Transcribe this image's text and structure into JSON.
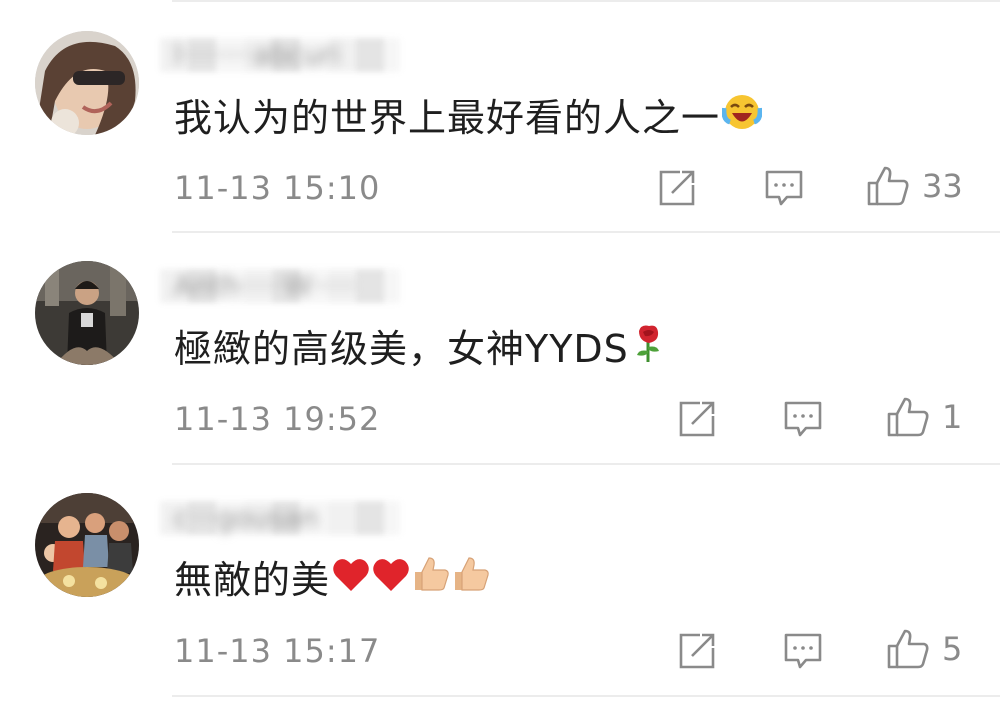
{
  "comments": [
    {
      "username": "l········abcuri",
      "text": "我认为的世界上最好看的人之一",
      "emoji": [
        "laughing-crying-emoji"
      ],
      "timestamp": "11-13 15:10",
      "likes": "33"
    },
    {
      "username": "Anth·····W·····",
      "text": "極緻的高级美，女神YYDS",
      "emoji": [
        "rose-emoji"
      ],
      "timestamp": "11-13 19:52",
      "likes": "1"
    },
    {
      "username": "c···gousan",
      "text": "無敵的美",
      "emoji": [
        "red-heart-emoji",
        "red-heart-emoji",
        "thumbs-up-emoji",
        "thumbs-up-emoji"
      ],
      "timestamp": "11-13 15:17",
      "likes": "5"
    }
  ],
  "icons": {
    "share": "share-icon",
    "comment": "comment-icon",
    "like": "like-icon"
  },
  "colors": {
    "meta_text": "#8a8a8a",
    "body_text": "#1f1f1f",
    "divider": "#ececec",
    "heart": "#e0242b",
    "rose": "#d1242f",
    "thumb": "#f5c9a0"
  }
}
